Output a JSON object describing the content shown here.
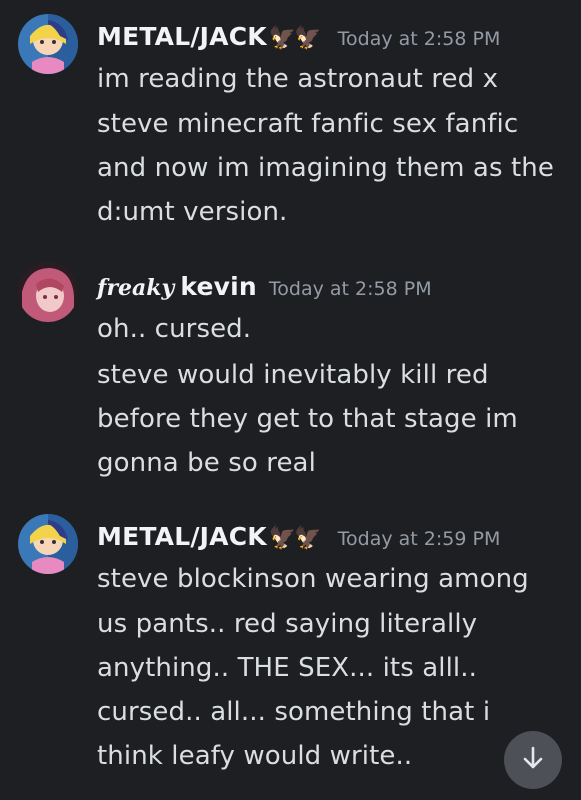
{
  "messages": [
    {
      "username": "METAL/JACK",
      "decoration": "🦅🦅",
      "timestamp": "Today at 2:58 PM",
      "lines": [
        "im reading the astronaut red x",
        "steve minecraft fanfic sex fanfic",
        "and now im imagining them as the",
        "d:umt version."
      ]
    },
    {
      "username_prefix": "freaky",
      "username": "kevin",
      "timestamp": "Today at 2:58 PM",
      "lines": [
        "oh.. cursed.",
        "steve would inevitably kill red",
        "before they get to that stage im",
        "gonna be so real"
      ]
    },
    {
      "username": "METAL/JACK",
      "decoration": "🦅🦅",
      "timestamp": "Today at 2:59 PM",
      "lines": [
        "steve blockinson wearing among",
        "us pants.. red saying literally",
        "anything.. THE SEX... its alll..",
        "cursed.. all... something that i",
        "think leafy would write.."
      ]
    }
  ],
  "scroll_button": {
    "icon": "arrow-down-icon"
  },
  "colors": {
    "background": "#1e1f22",
    "username": "#f2f3f5",
    "timestamp": "#949ba4",
    "message_text": "#dbdee1",
    "scroll_button_bg": "#4e5058"
  }
}
